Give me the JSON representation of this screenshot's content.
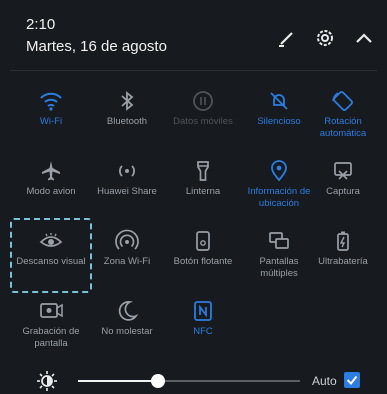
{
  "status": {
    "time": "2:10",
    "date": "Martes, 16 de agosto"
  },
  "header_icons": [
    "edit-icon",
    "settings-icon",
    "collapse-icon"
  ],
  "tiles": [
    {
      "label": "Wi-Fi",
      "state": "on",
      "icon": "wifi-icon"
    },
    {
      "label": "Bluetooth",
      "state": "off",
      "icon": "bluetooth-icon"
    },
    {
      "label": "Datos móviles",
      "state": "disabled",
      "icon": "mobile-data-icon"
    },
    {
      "label": "Silencioso",
      "state": "on",
      "icon": "silent-icon"
    },
    {
      "label": "Rotación automática",
      "state": "on",
      "icon": "auto-rotate-icon"
    },
    {
      "label": "Modo avion",
      "state": "off",
      "icon": "airplane-icon"
    },
    {
      "label": "Huawei Share",
      "state": "off",
      "icon": "share-icon"
    },
    {
      "label": "Linterna",
      "state": "off",
      "icon": "flashlight-icon"
    },
    {
      "label": "Información de ubicación",
      "state": "on",
      "icon": "location-icon"
    },
    {
      "label": "Captura",
      "state": "off",
      "icon": "screenshot-icon"
    },
    {
      "label": "Descanso visual",
      "state": "off",
      "icon": "eye-icon"
    },
    {
      "label": "Zona Wi-Fi",
      "state": "off",
      "icon": "hotspot-icon"
    },
    {
      "label": "Botón flotante",
      "state": "off",
      "icon": "floating-button-icon"
    },
    {
      "label": "Pantallas múltiples",
      "state": "off",
      "icon": "multi-screen-icon"
    },
    {
      "label": "Ultrabatería",
      "state": "off",
      "icon": "battery-icon"
    },
    {
      "label": "Grabación de pantalla",
      "state": "off",
      "icon": "screen-record-icon"
    },
    {
      "label": "No molestar",
      "state": "off",
      "icon": "moon-icon"
    },
    {
      "label": "NFC",
      "state": "on",
      "icon": "nfc-icon"
    }
  ],
  "brightness": {
    "level": 0.36,
    "auto_label": "Auto",
    "auto_checked": true
  },
  "colors": {
    "accent": "#2b7de0",
    "highlight_box": "#78c2d6",
    "background": "#171a1f"
  }
}
